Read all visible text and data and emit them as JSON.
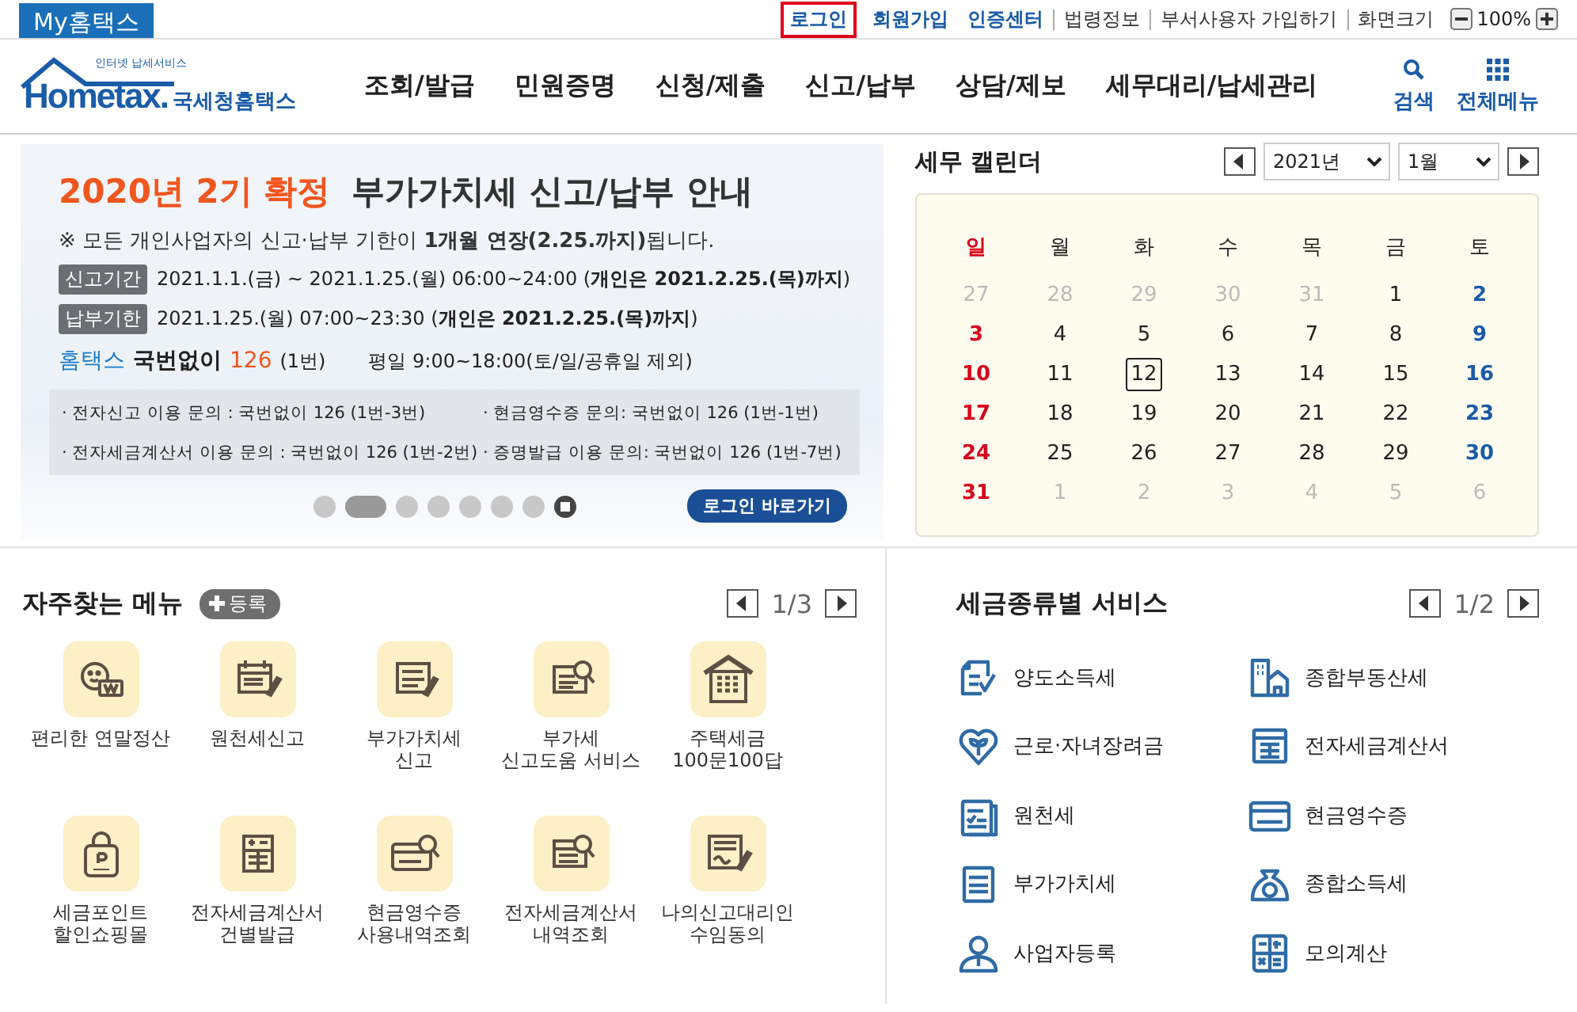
{
  "top_bar": {
    "my_home": "My홈택스",
    "links": [
      {
        "label": "로그인",
        "kind": "boxed"
      },
      {
        "label": "회원가입",
        "kind": "strong"
      },
      {
        "label": "인증센터",
        "kind": "strong"
      },
      {
        "label": "법령정보",
        "kind": "plain"
      },
      {
        "label": "부서사용자 가입하기",
        "kind": "plain"
      },
      {
        "label": "화면크기",
        "kind": "plain"
      }
    ],
    "zoom": "100%"
  },
  "header": {
    "logo": {
      "tagline": "인터넷 납세서비스",
      "brand": "Hometax.",
      "name": "국세청홈택스"
    },
    "nav": [
      "조회/발급",
      "민원증명",
      "신청/제출",
      "신고/납부",
      "상담/제보",
      "세무대리/납세관리"
    ],
    "tools": [
      {
        "label": "검색",
        "kind": "search"
      },
      {
        "label": "전체메뉴",
        "kind": "menu"
      }
    ]
  },
  "banner": {
    "highlight": "2020년 2기 확정",
    "title": "부가가치세 신고/납부 안내",
    "notice": "※ 모든 개인사업자의 신고·납부 기한이 **1개월 연장(2.25.까지)**됩니다.",
    "periods": [
      {
        "tag": "신고기간",
        "text": "2021.1.1.(금) ~ 2021.1.25.(월) 06:00~24:00 (**개인은 2021.2.25.(목)까지**)"
      },
      {
        "tag": "납부기한",
        "text": "2021.1.25.(월) 07:00~23:30 (**개인은 2021.2.25.(목)까지**)"
      }
    ],
    "contact": {
      "brand": "홈택스",
      "label": "국번없이",
      "number": "126",
      "sub": "(1번)",
      "hours": "평일 9:00~18:00(토/일/공휴일 제외)"
    },
    "inquiries": [
      "· 전자신고 이용 문의 : 국번없이 126 (1번-3번)",
      "· 현금영수증 문의: 국번없이 126 (1번-1번)",
      "· 전자세금계산서 이용 문의 : 국번없이 126 (1번-2번)",
      "· 증명발급 이용 문의: 국번없이 126 (1번-7번)"
    ],
    "slides": [
      {
        "selected": false
      },
      {
        "selected": true
      },
      {
        "selected": false
      },
      {
        "selected": false
      },
      {
        "selected": false
      },
      {
        "selected": false
      },
      {
        "selected": false
      }
    ],
    "login_button": "로그인 바로가기"
  },
  "calendar": {
    "title": "세무 캘린더",
    "year": "2021년",
    "month": "1월",
    "weekdays": [
      "일",
      "월",
      "화",
      "수",
      "목",
      "금",
      "토"
    ],
    "days": [
      {
        "day": "27",
        "other_month": true,
        "today": false
      },
      {
        "day": "28",
        "other_month": true,
        "today": false
      },
      {
        "day": "29",
        "other_month": true,
        "today": false
      },
      {
        "day": "30",
        "other_month": true,
        "today": false
      },
      {
        "day": "31",
        "other_month": true,
        "today": false
      },
      {
        "day": "1",
        "other_month": false,
        "today": false
      },
      {
        "day": "2",
        "other_month": false,
        "today": false
      },
      {
        "day": "3",
        "other_month": false,
        "today": false
      },
      {
        "day": "4",
        "other_month": false,
        "today": false
      },
      {
        "day": "5",
        "other_month": false,
        "today": false
      },
      {
        "day": "6",
        "other_month": false,
        "today": false
      },
      {
        "day": "7",
        "other_month": false,
        "today": false
      },
      {
        "day": "8",
        "other_month": false,
        "today": false
      },
      {
        "day": "9",
        "other_month": false,
        "today": false
      },
      {
        "day": "10",
        "other_month": false,
        "today": false
      },
      {
        "day": "11",
        "other_month": false,
        "today": false
      },
      {
        "day": "12",
        "other_month": false,
        "today": true
      },
      {
        "day": "13",
        "other_month": false,
        "today": false
      },
      {
        "day": "14",
        "other_month": false,
        "today": false
      },
      {
        "day": "15",
        "other_month": false,
        "today": false
      },
      {
        "day": "16",
        "other_month": false,
        "today": false
      },
      {
        "day": "17",
        "other_month": false,
        "today": false
      },
      {
        "day": "18",
        "other_month": false,
        "today": false
      },
      {
        "day": "19",
        "other_month": false,
        "today": false
      },
      {
        "day": "20",
        "other_month": false,
        "today": false
      },
      {
        "day": "21",
        "other_month": false,
        "today": false
      },
      {
        "day": "22",
        "other_month": false,
        "today": false
      },
      {
        "day": "23",
        "other_month": false,
        "today": false
      },
      {
        "day": "24",
        "other_month": false,
        "today": false
      },
      {
        "day": "25",
        "other_month": false,
        "today": false
      },
      {
        "day": "26",
        "other_month": false,
        "today": false
      },
      {
        "day": "27",
        "other_month": false,
        "today": false
      },
      {
        "day": "28",
        "other_month": false,
        "today": false
      },
      {
        "day": "29",
        "other_month": false,
        "today": false
      },
      {
        "day": "30",
        "other_month": false,
        "today": false
      },
      {
        "day": "31",
        "other_month": false,
        "today": false
      },
      {
        "day": "1",
        "other_month": true,
        "today": false
      },
      {
        "day": "2",
        "other_month": true,
        "today": false
      },
      {
        "day": "3",
        "other_month": true,
        "today": false
      },
      {
        "day": "4",
        "other_month": true,
        "today": false
      },
      {
        "day": "5",
        "other_month": true,
        "today": false
      },
      {
        "day": "6",
        "other_month": true,
        "today": false
      }
    ]
  },
  "frequent_menu": {
    "title": "자주찾는 메뉴",
    "add_button": "등록",
    "pager": "1/3",
    "items": [
      {
        "label": "편리한 연말정산",
        "kind": "settlement"
      },
      {
        "label": "원천세신고",
        "kind": "withholding"
      },
      {
        "label": "부가가치세\n신고",
        "kind": "vat"
      },
      {
        "label": "부가세\n신고도움 서비스",
        "kind": "vat_help"
      },
      {
        "label": "주택세금\n100문100답",
        "kind": "housing"
      },
      {
        "label": "세금포인트\n할인쇼핑몰",
        "kind": "points"
      },
      {
        "label": "전자세금계산서\n건별발급",
        "kind": "invoice_issue"
      },
      {
        "label": "현금영수증\n사용내역조회",
        "kind": "cash_receipt"
      },
      {
        "label": "전자세금계산서\n내역조회",
        "kind": "invoice_query"
      },
      {
        "label": "나의신고대리인\n수임동의",
        "kind": "agent"
      }
    ]
  },
  "tax_services": {
    "title": "세금종류별 서비스",
    "pager": "1/2",
    "items": [
      {
        "label": "양도소득세",
        "kind": "transfer"
      },
      {
        "label": "종합부동산세",
        "kind": "property"
      },
      {
        "label": "근로·자녀장려금",
        "kind": "earned"
      },
      {
        "label": "전자세금계산서",
        "kind": "e_invoice"
      },
      {
        "label": "원천세",
        "kind": "withholding"
      },
      {
        "label": "현금영수증",
        "kind": "cash"
      },
      {
        "label": "부가가치세",
        "kind": "vat"
      },
      {
        "label": "종합소득세",
        "kind": "income"
      },
      {
        "label": "사업자등록",
        "kind": "business"
      },
      {
        "label": "모의계산",
        "kind": "simulation"
      }
    ]
  }
}
